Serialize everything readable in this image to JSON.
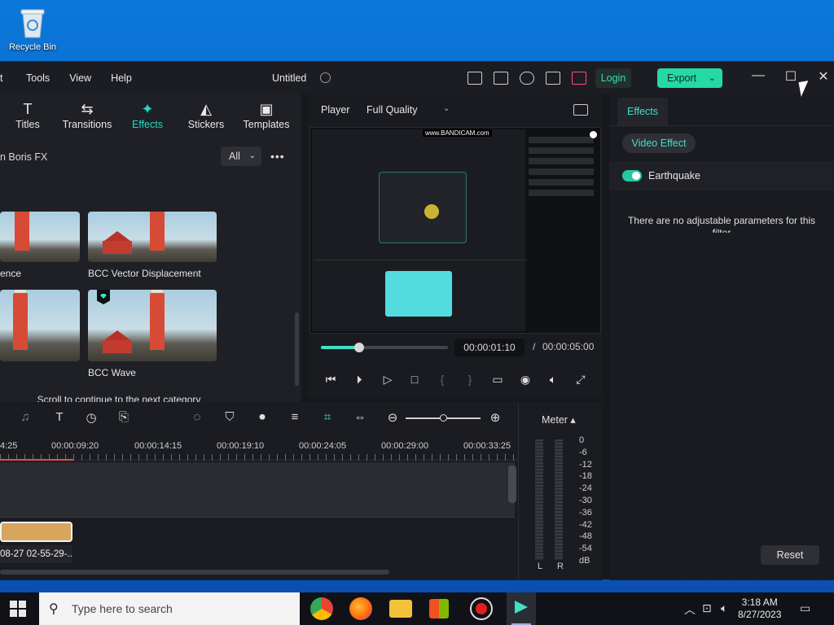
{
  "desktop": {
    "recycle_bin_label": "Recycle Bin"
  },
  "app": {
    "menu": [
      "Tools",
      "View",
      "Help"
    ],
    "document_title": "Untitled",
    "login_label": "Login",
    "export_label": "Export",
    "colors": {
      "accent": "#25d9a4",
      "cyan": "#3fe0c7",
      "cart": "#ff4d7d"
    }
  },
  "library": {
    "tabs": [
      {
        "label": "Titles",
        "icon": "title-icon"
      },
      {
        "label": "Transitions",
        "icon": "transitions-icon"
      },
      {
        "label": "Effects",
        "icon": "effects-icon",
        "active": true
      },
      {
        "label": "Stickers",
        "icon": "stickers-icon"
      },
      {
        "label": "Templates",
        "icon": "templates-icon"
      }
    ],
    "category": "n Boris FX",
    "filter": "All",
    "items": [
      {
        "label": "ence"
      },
      {
        "label": "BCC Vector Displacement"
      },
      {
        "label": ""
      },
      {
        "label": "BCC Wave",
        "premium": true
      }
    ],
    "scroll_message": "Scroll to continue to the next category"
  },
  "player": {
    "label": "Player",
    "quality": "Full Quality",
    "current_time": "00:00:01:10",
    "separator": "/",
    "total_time": "00:00:05:00",
    "progress": 0.3,
    "watermark": "www.BANDICAM.com"
  },
  "properties": {
    "tab": "Effects",
    "video_effect": "Video Effect",
    "effect_name": "Earthquake",
    "effect_enabled": true,
    "no_params": "There are no adjustable parameters for this filter",
    "reset_label": "Reset"
  },
  "timeline": {
    "ruler": [
      "4:25",
      "00:00:09:20",
      "00:00:14:15",
      "00:00:19:10",
      "00:00:24:05",
      "00:00:29:00",
      "00:00:33:25"
    ],
    "clip_label": "08-27 02-55-29-..."
  },
  "meter": {
    "label": "Meter ▴",
    "scale": [
      "0",
      "-6",
      "-12",
      "-18",
      "-24",
      "-30",
      "-36",
      "-42",
      "-48",
      "-54",
      "dB"
    ],
    "left": "L",
    "right": "R"
  },
  "taskbar": {
    "search_placeholder": "Type here to search",
    "time": "3:18 AM",
    "date": "8/27/2023"
  }
}
